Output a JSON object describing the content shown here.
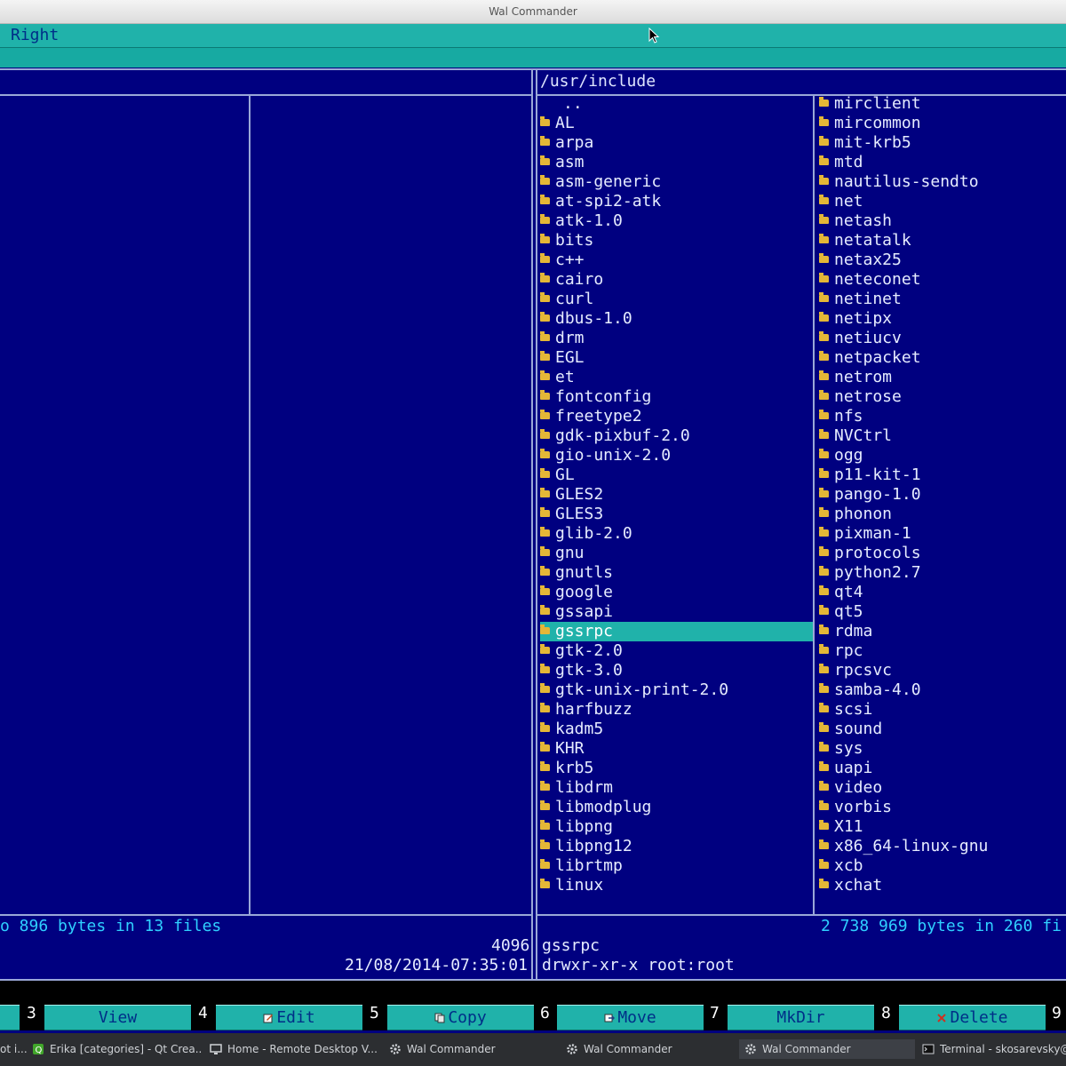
{
  "window": {
    "title": "Wal Commander"
  },
  "menu": {
    "visible_item": "Right"
  },
  "right_panel": {
    "path": "/usr/include",
    "col1": [
      "..",
      "AL",
      "arpa",
      "asm",
      "asm-generic",
      "at-spi2-atk",
      "atk-1.0",
      "bits",
      "c++",
      "cairo",
      "curl",
      "dbus-1.0",
      "drm",
      "EGL",
      "et",
      "fontconfig",
      "freetype2",
      "gdk-pixbuf-2.0",
      "gio-unix-2.0",
      "GL",
      "GLES2",
      "GLES3",
      "glib-2.0",
      "gnu",
      "gnutls",
      "google",
      "gssapi",
      "gssrpc",
      "gtk-2.0",
      "gtk-3.0",
      "gtk-unix-print-2.0",
      "harfbuzz",
      "kadm5",
      "KHR",
      "krb5",
      "libdrm",
      "libmodplug",
      "libpng",
      "libpng12",
      "librtmp",
      "linux"
    ],
    "col2": [
      "mirclient",
      "mircommon",
      "mit-krb5",
      "mtd",
      "nautilus-sendto",
      "net",
      "netash",
      "netatalk",
      "netax25",
      "neteconet",
      "netinet",
      "netipx",
      "netiucv",
      "netpacket",
      "netrom",
      "netrose",
      "nfs",
      "NVCtrl",
      "ogg",
      "p11-kit-1",
      "pango-1.0",
      "phonon",
      "pixman-1",
      "protocols",
      "python2.7",
      "qt4",
      "qt5",
      "rdma",
      "rpc",
      "rpcsvc",
      "samba-4.0",
      "scsi",
      "sound",
      "sys",
      "uapi",
      "video",
      "vorbis",
      "X11",
      "x86_64-linux-gnu",
      "xcb",
      "xchat"
    ],
    "selected": "gssrpc",
    "status": "2 738 969 bytes in 260 fi",
    "info_name": "gssrpc",
    "info_attr": "drwxr-xr-x  root:root"
  },
  "left_panel": {
    "status": "o 896 bytes in 13 files",
    "info_size": "4096",
    "info_date": "21/08/2014-07:35:01"
  },
  "fkeys": [
    {
      "num": "3",
      "label": "View"
    },
    {
      "num": "4",
      "label": "Edit"
    },
    {
      "num": "5",
      "label": "Copy"
    },
    {
      "num": "6",
      "label": "Move"
    },
    {
      "num": "7",
      "label": "MkDir"
    },
    {
      "num": "8",
      "label": "Delete"
    },
    {
      "num": "9",
      "label": ""
    }
  ],
  "taskbar": [
    {
      "label": "ot i...",
      "icon": "app-icon"
    },
    {
      "label": "Erika [categories] - Qt Crea...",
      "icon": "qtcreator-icon"
    },
    {
      "label": "Home - Remote Desktop V...",
      "icon": "remote-desktop-icon"
    },
    {
      "label": "Wal Commander",
      "icon": "gear-icon"
    },
    {
      "label": "Wal Commander",
      "icon": "gear-icon"
    },
    {
      "label": "Wal Commander",
      "icon": "gear-icon",
      "active": true
    },
    {
      "label": "Terminal - skosarevsky@...",
      "icon": "terminal-icon"
    }
  ],
  "colors": {
    "panel_bg": "#000080",
    "accent": "#20b2aa",
    "folder": "#e4b737",
    "status_text": "#2fd0ff"
  }
}
